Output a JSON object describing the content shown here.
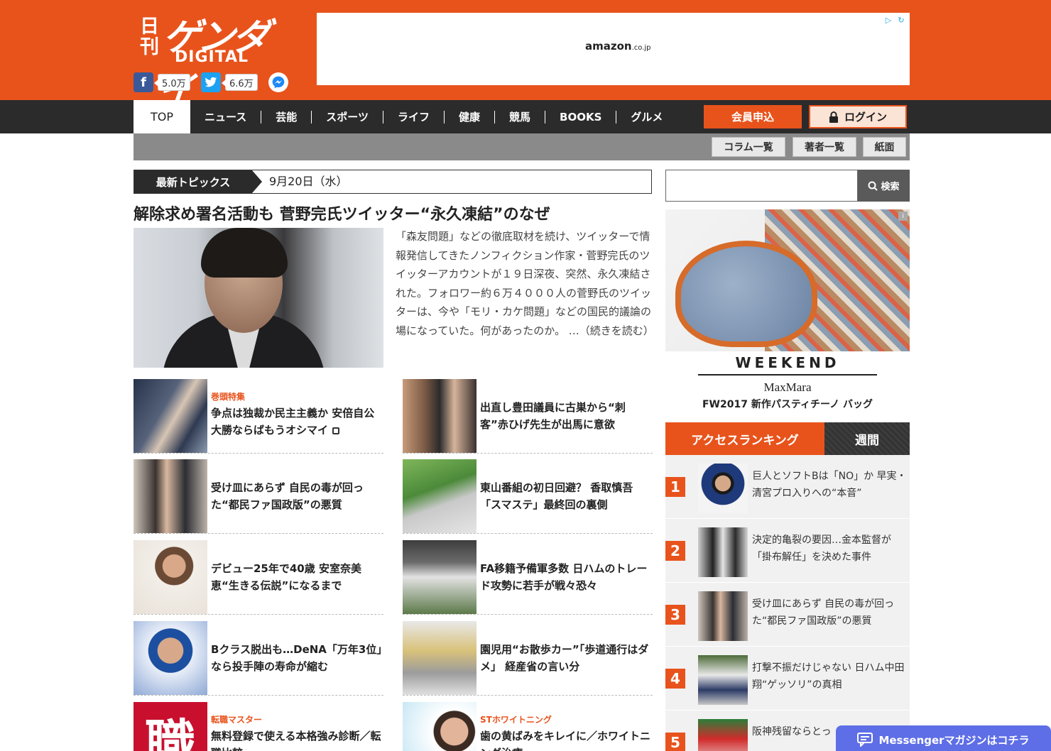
{
  "header": {
    "logo": {
      "nikkan": "日刊",
      "gendai": "ゲンダイ",
      "digital": "DIGITAL"
    },
    "facebook": {
      "icon": "facebook-icon",
      "count": "5.0万"
    },
    "twitter": {
      "icon": "twitter-icon",
      "count": "6.6万"
    },
    "messenger_icon": "messenger-icon",
    "ad": {
      "brand": "amazon",
      "suffix": ".co.jp"
    }
  },
  "nav": {
    "top": "TOP",
    "items": [
      "ニュース",
      "芸能",
      "スポーツ",
      "ライフ",
      "健康",
      "競馬",
      "BOOKS",
      "グルメ"
    ],
    "join": "会員申込",
    "login": "ログイン"
  },
  "subnav": [
    "コラム一覧",
    "著者一覧",
    "紙面"
  ],
  "topics": {
    "label": "最新トピックス",
    "date": "9月20日（水）"
  },
  "lead": {
    "headline": "解除求め署名活動も 菅野完氏ツイッター“永久凍結”のなぜ",
    "text": "「森友問題」などの徹底取材を続け、ツイッターで情報発信してきたノンフィクション作家・菅野完氏のツイッターアカウントが１９日深夜、突然、永久凍結された。フォロワー約６万４０００人の菅野氏のツイッターは、今や「モリ・カケ問題」などの国民的議論の場になっていた。何があったのか。 …（続きを読む）"
  },
  "articles": [
    {
      "cat": "巻頭特集",
      "title": "争点は独裁か民主主義か 安倍自公大勝ならばもうオシマイ",
      "locked": true
    },
    {
      "cat": "",
      "title": "出直し豊田議員に古巣から“刺客”赤ひげ先生が出馬に意欲"
    },
    {
      "cat": "",
      "title": "受け皿にあらず 自民の毒が回った“都民ファ国政版”の悪質"
    },
    {
      "cat": "",
      "title": "東山番組の初日回避？ 香取慎吾「スマステ」最終回の裏側"
    },
    {
      "cat": "",
      "title": "デビュー25年で40歳 安室奈美恵“生きる伝説”になるまで"
    },
    {
      "cat": "",
      "title": "FA移籍予備軍多数 日ハムのトレード攻勢に若手が戦々恐々"
    },
    {
      "cat": "",
      "title": "Bクラス脱出も…DeNA「万年3位」なら投手陣の寿命が縮む"
    },
    {
      "cat": "",
      "title": "園児用“お散歩カー”「歩道通行はダメ」 経産省の言い分"
    },
    {
      "cat": "転職マスター",
      "title": "無料登録で使える本格強み診断／転職比較",
      "thumb_text": "職"
    },
    {
      "cat": "STホワイトニング",
      "title": "歯の黄ばみをキレイに／ホワイトニング治療"
    }
  ],
  "sidebar": {
    "search_label": "検索",
    "ad": {
      "weekend": "WEEKEND",
      "brand": "MaxMara",
      "caption": "FW2017 新作パスティチーノ バッグ",
      "info": "i"
    },
    "ranking": {
      "title": "アクセスランキング",
      "period": "週間",
      "items": [
        {
          "rank": "1",
          "title": "巨人とソフトBは「NO」か 早実・清宮プロ入りへの“本音”"
        },
        {
          "rank": "2",
          "title": "決定的亀裂の要因…金本監督が「掛布解任」を決めた事件"
        },
        {
          "rank": "3",
          "title": "受け皿にあらず 自民の毒が回った“都民ファ国政版”の悪質"
        },
        {
          "rank": "4",
          "title": "打撃不振だけじゃない 日ハム中田翔“ゲッソリ”の真相"
        },
        {
          "rank": "5",
          "title": "阪神残留ならとっ"
        }
      ]
    }
  },
  "messenger_bar": "Messengerマガジンはコチラ",
  "colors": {
    "brand": "#e8531c",
    "nav": "#2b2b2b",
    "messenger": "#5e6ee6"
  }
}
